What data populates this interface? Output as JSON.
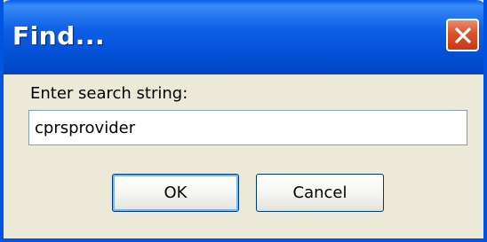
{
  "window": {
    "title": "Find..."
  },
  "titlebar": {
    "close_icon": "close-icon"
  },
  "form": {
    "prompt_label": "Enter search string:",
    "search_value": "cprsprovider"
  },
  "buttons": {
    "ok_label": "OK",
    "cancel_label": "Cancel"
  },
  "colors": {
    "titlebar_blue": "#0054e3",
    "dialog_background": "#ece9d8",
    "close_button_red": "#d9532c"
  }
}
